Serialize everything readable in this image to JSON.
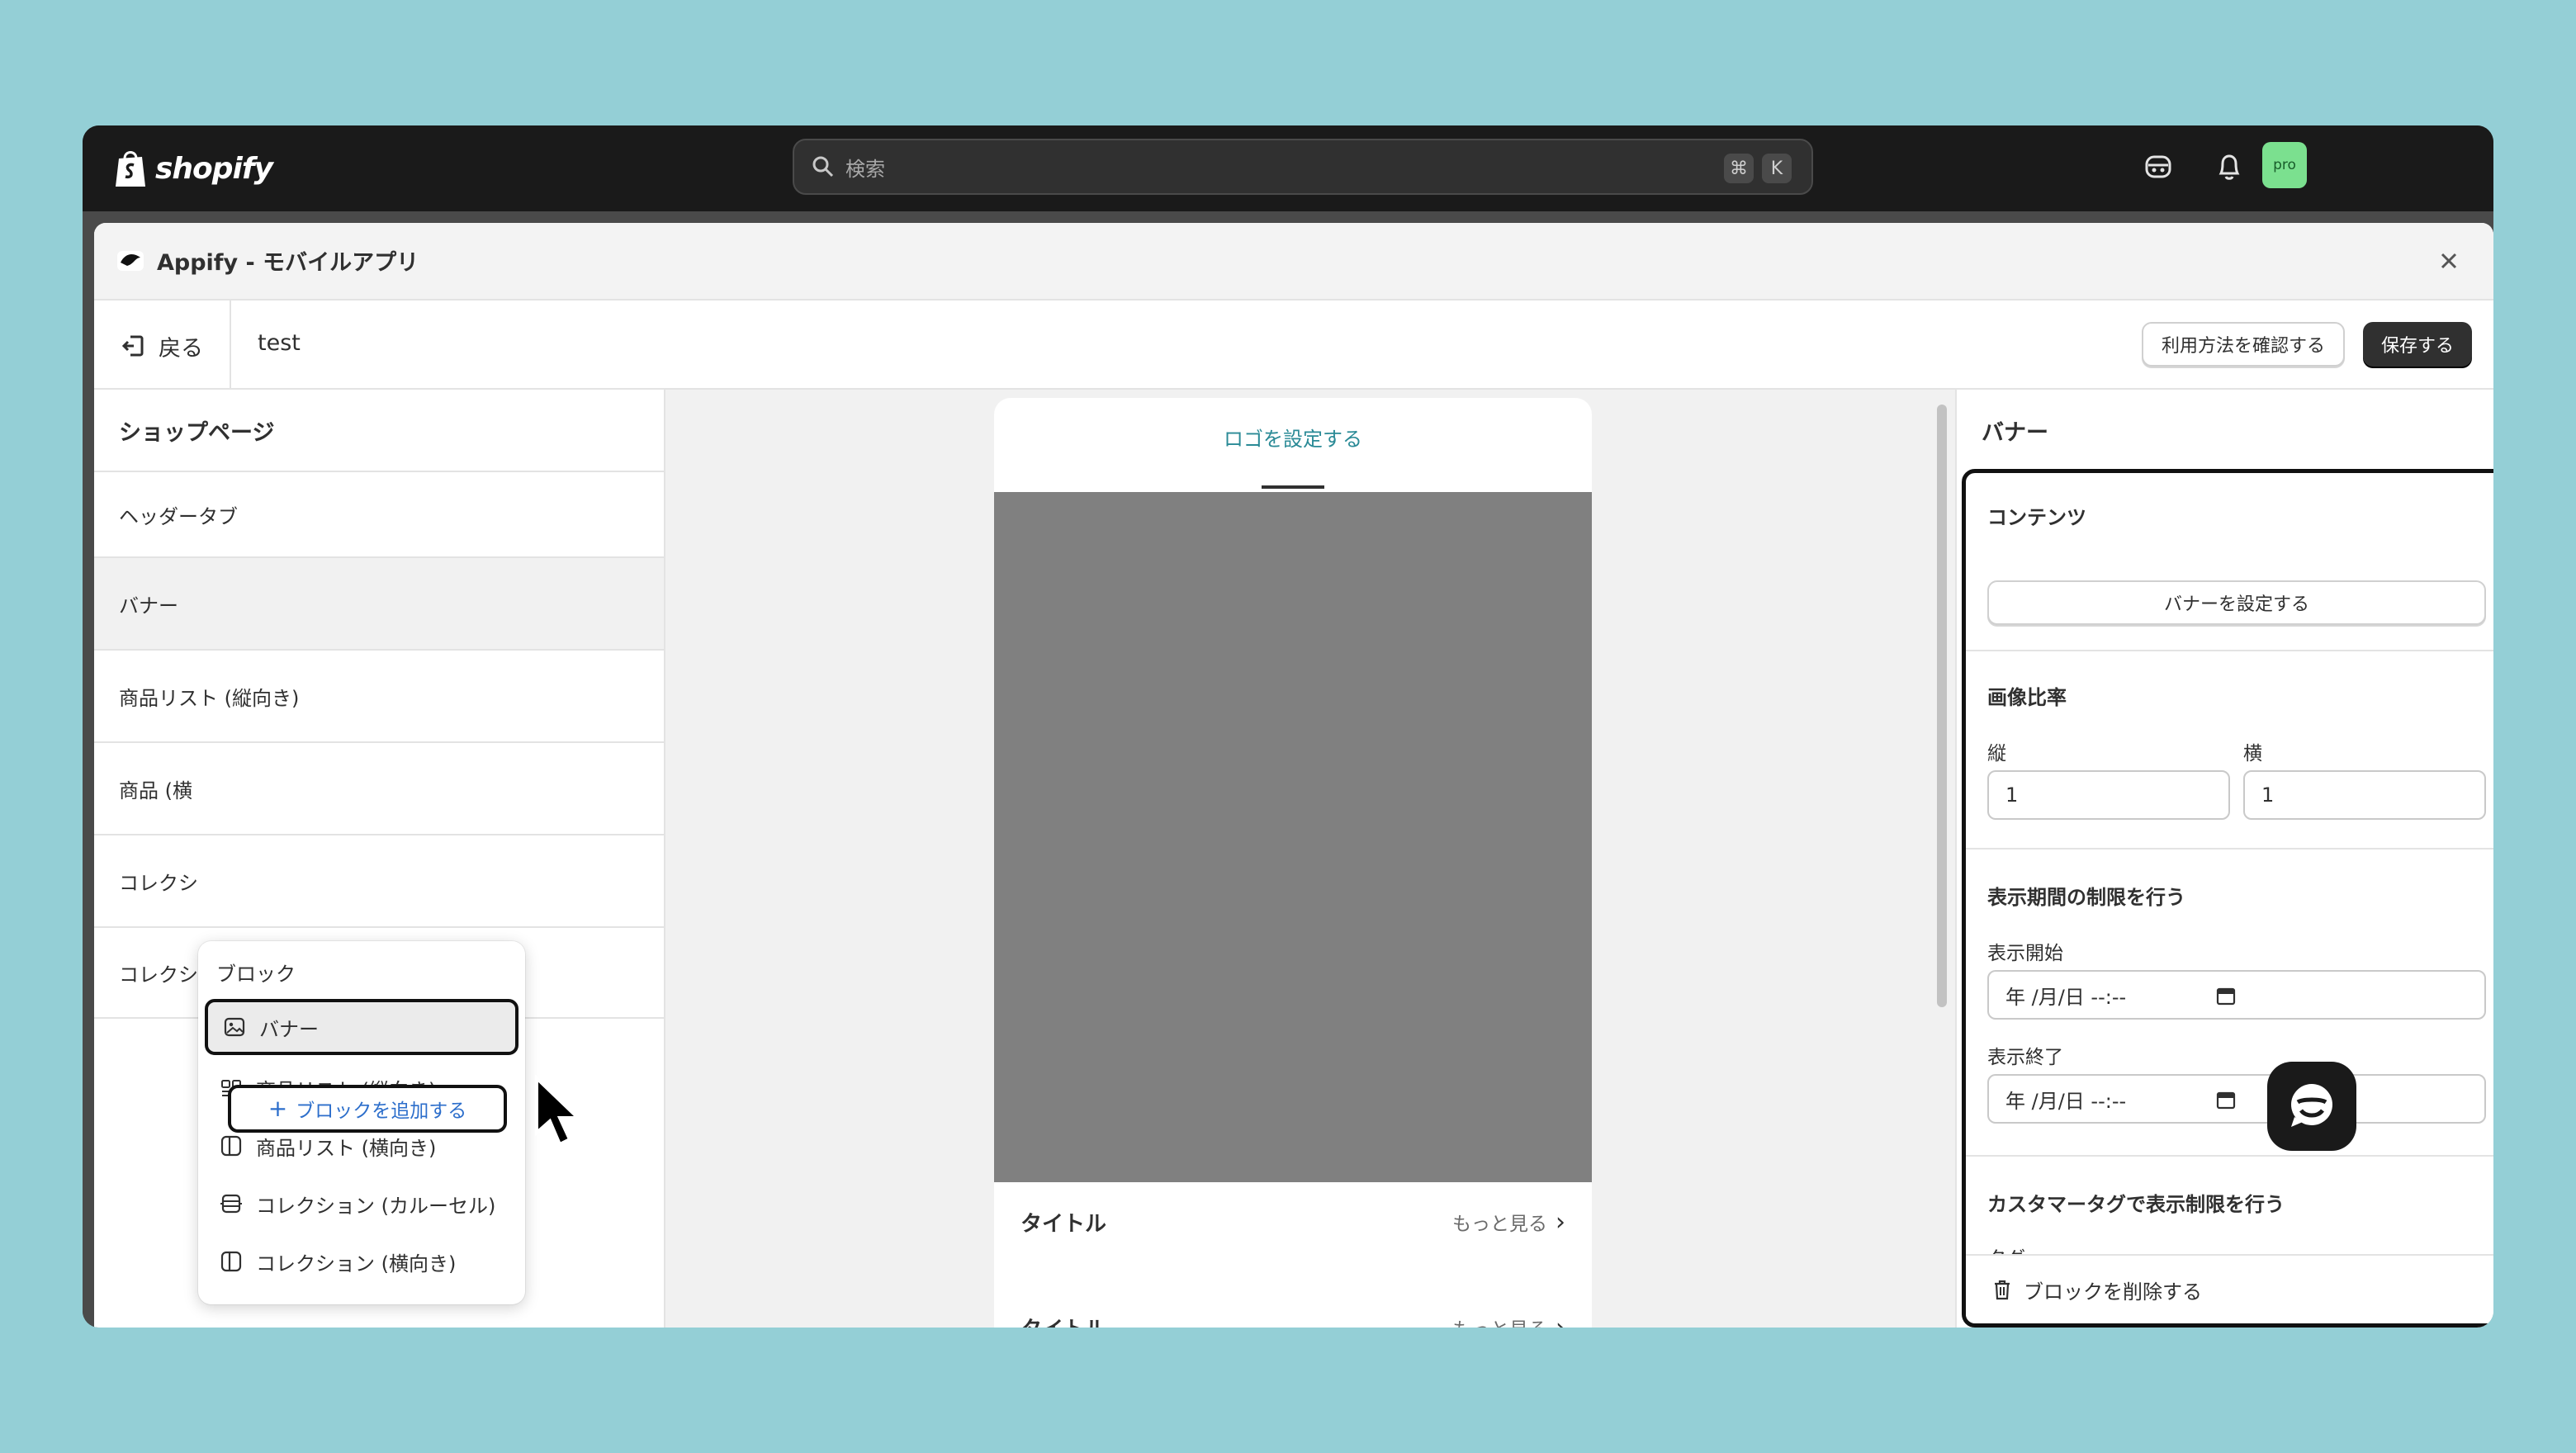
{
  "topbar": {
    "brand": "shopify",
    "search_placeholder": "検索",
    "shortcut_cmd": "⌘",
    "shortcut_key": "K",
    "avatar_label": "pro",
    "avatar_color": "#7be08f"
  },
  "app": {
    "title": "Appify - モバイルアプリ"
  },
  "subheader": {
    "back_label": "戻る",
    "page_name": "test",
    "help_button": "利用方法を確認する",
    "save_button": "保存する"
  },
  "sidebar": {
    "heading": "ショップページ",
    "items": [
      {
        "label": "ヘッダータブ"
      },
      {
        "label": "バナー"
      },
      {
        "label": "商品リスト (縦向き)"
      },
      {
        "label": "商品 (横"
      },
      {
        "label": "コレクシ"
      },
      {
        "label": "コレクシ"
      }
    ],
    "add_block_label": "ブロックを追加する"
  },
  "block_menu": {
    "title": "ブロック",
    "items": [
      {
        "label": "バナー",
        "icon": "banner-icon"
      },
      {
        "label": "商品リスト (縦向き)",
        "icon": "grid-icon"
      },
      {
        "label": "商品リスト (横向き)",
        "icon": "columns-icon"
      },
      {
        "label": "コレクション (カルーセル)",
        "icon": "carousel-icon"
      },
      {
        "label": "コレクション (横向き)",
        "icon": "columns-icon"
      }
    ]
  },
  "preview": {
    "logo_link": "ロゴを設定する",
    "rows": [
      {
        "title": "タイトル",
        "more": "もっと見る"
      },
      {
        "title": "タイトル",
        "more": "もっと見る"
      }
    ]
  },
  "settings": {
    "heading": "バナー",
    "contents_title": "コンテンツ",
    "set_banner_button": "バナーを設定する",
    "ratio_title": "画像比率",
    "ratio_vertical_label": "縦",
    "ratio_vertical_value": "1",
    "ratio_horizontal_label": "横",
    "ratio_horizontal_value": "1",
    "period_title": "表示期間の制限を行う",
    "start_label": "表示開始",
    "start_value": "年 /月/日 --:--",
    "end_label": "表示終了",
    "end_value": "年 /月/日 --:--",
    "customer_tag_title": "カスタマータグで表示制限を行う",
    "tag_label": "タグ",
    "delete_label": "ブロックを削除する"
  }
}
